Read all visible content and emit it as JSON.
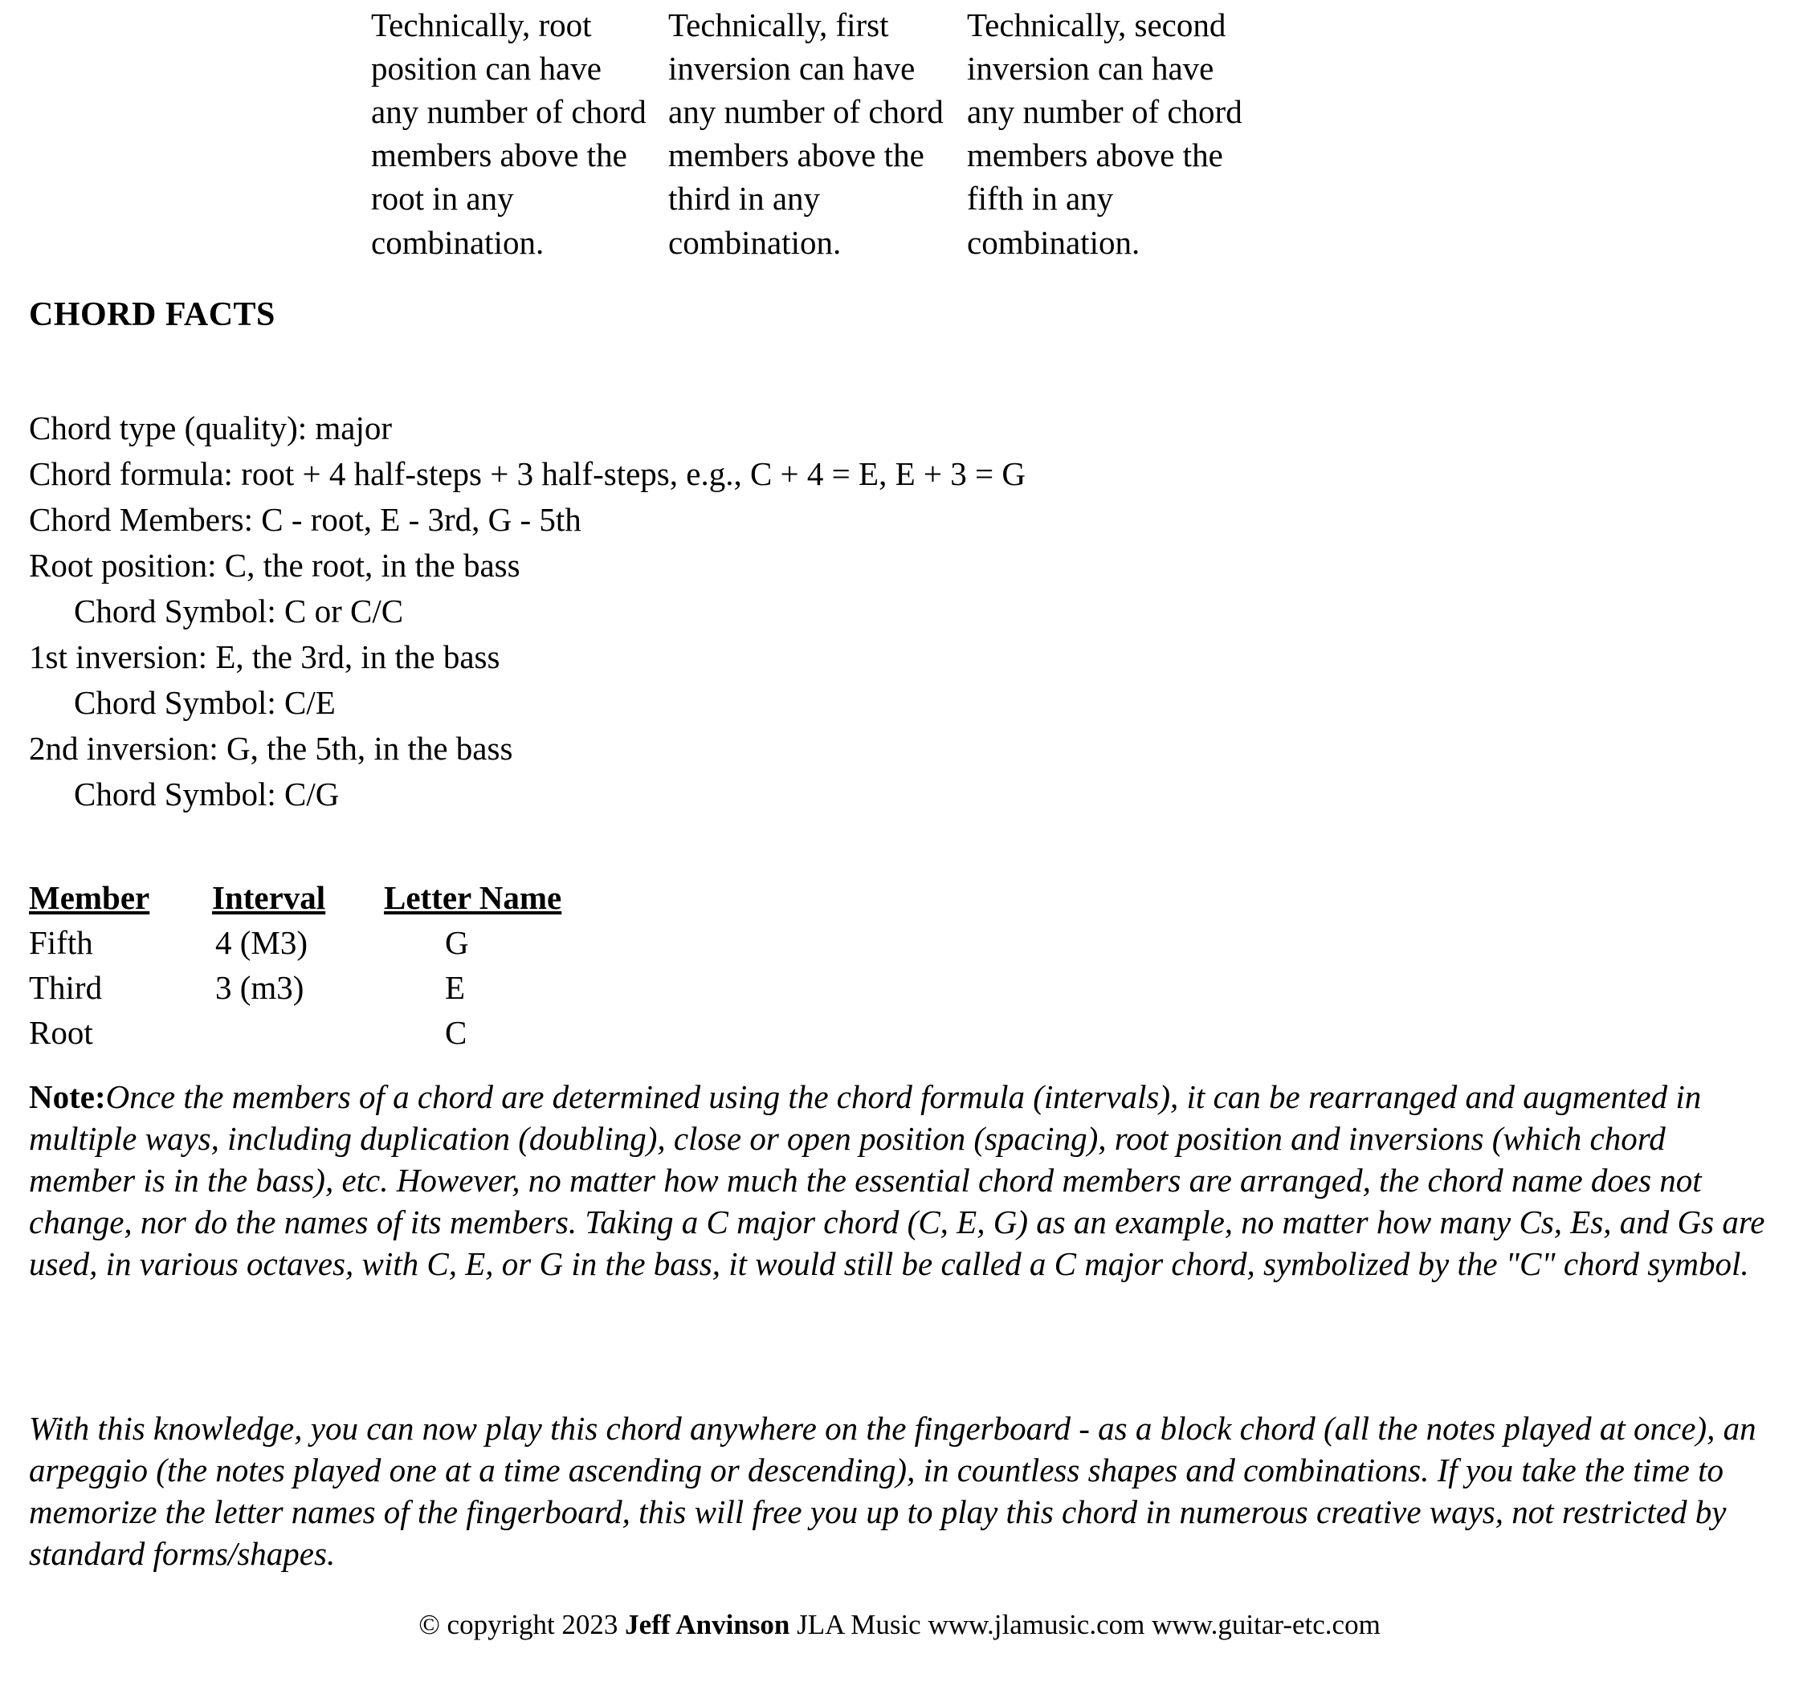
{
  "top_columns": [
    {
      "id": "root-position-note",
      "text": "Technically, root position can have any number of chord members above the root in any combination."
    },
    {
      "id": "first-inversion-note",
      "text": "Technically, first inversion can have any number of chord members above the third in any combination."
    },
    {
      "id": "second-inversion-note",
      "text": "Technically, second inversion can have any number of chord members above the fifth in any combination."
    }
  ],
  "chord_facts": {
    "heading": "CHORD FACTS",
    "lines": [
      {
        "text": "Chord type (quality): major",
        "indent": false
      },
      {
        "text": "Chord formula: root + 4 half-steps + 3 half-steps, e.g., C + 4 = E, E + 3 = G",
        "indent": false
      },
      {
        "text": "Chord Members: C - root, E - 3rd, G - 5th",
        "indent": false
      },
      {
        "text": "Root position: C, the root, in the bass",
        "indent": false
      },
      {
        "text": "Chord Symbol: C or C/C",
        "indent": true
      },
      {
        "text": "1st inversion: E, the 3rd, in the bass",
        "indent": false
      },
      {
        "text": "Chord Symbol: C/E",
        "indent": true
      },
      {
        "text": "2nd inversion: G, the 5th, in the bass",
        "indent": false
      },
      {
        "text": "Chord Symbol: C/G",
        "indent": true
      }
    ]
  },
  "chord_table": {
    "headers": [
      "Member",
      "Interval",
      "Letter Name"
    ],
    "rows": [
      {
        "member": "Fifth",
        "interval": "4  (M3)",
        "letter": "G"
      },
      {
        "member": "Third",
        "interval": "3  (m3)",
        "letter": "E"
      },
      {
        "member": "Root",
        "interval": "",
        "letter": "C"
      }
    ]
  },
  "notes": {
    "note_label": "Note",
    "note_colon": ":",
    "note_body": "Once the members of a chord are determined using the chord formula (intervals), it can be rearranged and augmented in multiple ways, including duplication (doubling), close or open position (spacing), root position and inversions (which chord member is in the bass), etc. However, no matter how much the essential chord members are arranged, the chord name does not change, nor do the names of its members. Taking a C major chord (C, E, G) as an example, no matter how many Cs, Es, and Gs are used, in various octaves, with C, E, or G in the bass, it would still be called a C major chord, symbolized by the \"C\" chord symbol.",
    "second_paragraph": "With this knowledge, you can now play this chord anywhere on the fingerboard - as a block chord (all the notes played at once), an arpeggio (the notes played one at a time ascending or descending), in countless shapes and combinations. If you take the time to memorize the letter names of the fingerboard, this will free you up to play this chord in numerous creative ways, not restricted by standard forms/shapes."
  },
  "footer": {
    "copyright_prefix": "© copyright 2023 ",
    "author": "Jeff Anvinson",
    "copyright_suffix": " JLA Music www.jlamusic.com www.guitar-etc.com"
  }
}
